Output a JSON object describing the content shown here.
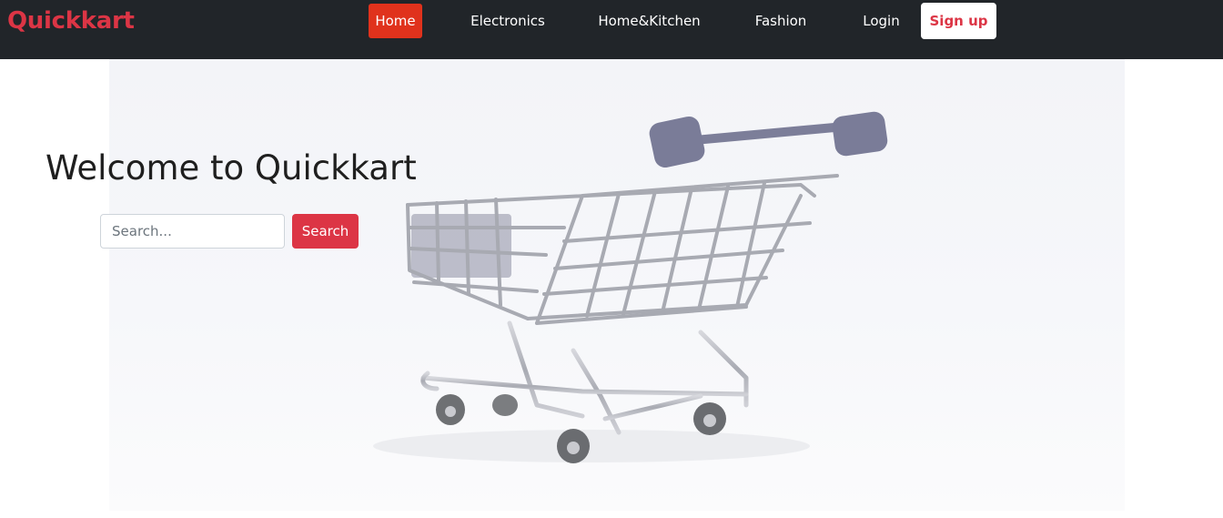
{
  "brand": {
    "name": "Quickkart",
    "color": "#dc3545"
  },
  "nav": {
    "items": [
      {
        "label": "Home",
        "active": true
      },
      {
        "label": "Electronics",
        "active": false
      },
      {
        "label": "Home&Kitchen",
        "active": false
      },
      {
        "label": "Fashion",
        "active": false
      },
      {
        "label": "Login",
        "active": false
      }
    ],
    "signup_label": "Sign up"
  },
  "hero": {
    "title": "Welcome to Quickkart",
    "image": "shopping-cart-photo"
  },
  "search": {
    "placeholder": "Search...",
    "value": "",
    "button_label": "Search"
  },
  "colors": {
    "navbar_bg": "#212529",
    "active_nav": "#e0321c",
    "accent": "#dc3545"
  }
}
